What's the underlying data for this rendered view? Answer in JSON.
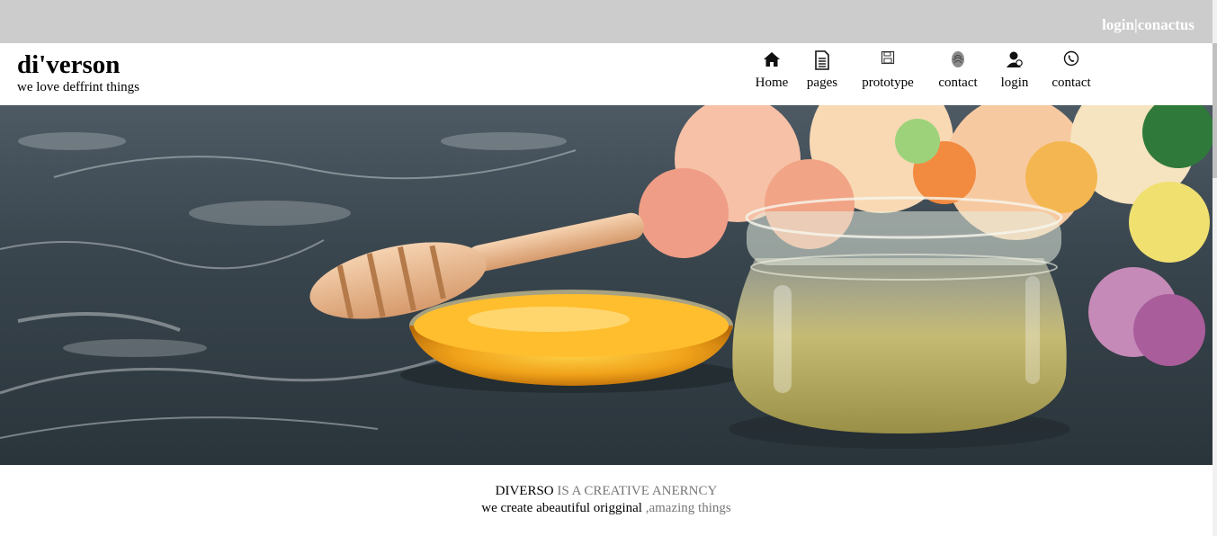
{
  "topbar": {
    "login": "login",
    "separator": "|",
    "contact": "conactus"
  },
  "brand": {
    "name": "di'verson",
    "tagline": "we love deffrint things"
  },
  "nav": [
    {
      "label": "Home",
      "icon": "home-icon"
    },
    {
      "label": "pages",
      "icon": "document-icon"
    },
    {
      "label": "prototype",
      "icon": "floppy-disk-icon"
    },
    {
      "label": "contact",
      "icon": "fingerprint-icon"
    },
    {
      "label": "login",
      "icon": "user-icon"
    },
    {
      "label": "contact",
      "icon": "phone-icon"
    }
  ],
  "hero": {
    "image": "honey-jar-and-flowers-photo"
  },
  "intro": {
    "line1_strong": "DIVERSO",
    "line1_rest": " IS A CREATIVE ANERNCY",
    "line2_strong": "we create abeautiful origginal",
    "line2_rest": " ,amazing things"
  },
  "colors": {
    "topbar": "#cccccc",
    "muted_text": "#777777"
  }
}
